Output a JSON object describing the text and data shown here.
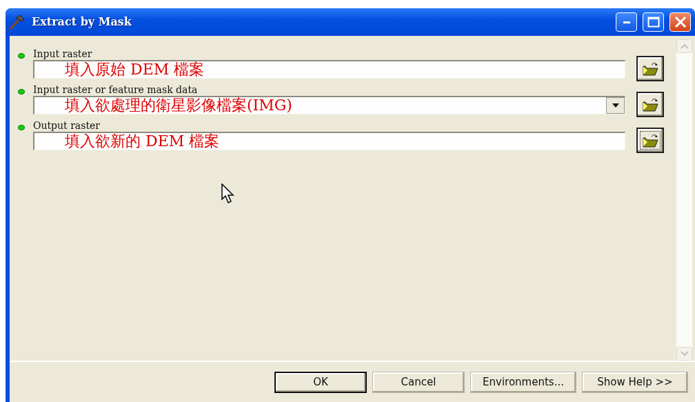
{
  "window": {
    "title": "Extract by Mask"
  },
  "parameters": [
    {
      "label": "Input raster",
      "value": "填入原始 DEM 檔案",
      "kind": "text",
      "required": true,
      "focused": false
    },
    {
      "label": "Input raster or feature mask data",
      "value": "填入欲處理的衛星影像檔案(IMG)",
      "kind": "dropdown",
      "required": true,
      "focused": false
    },
    {
      "label": "Output raster",
      "value": "填入欲新的 DEM 檔案",
      "kind": "text",
      "required": true,
      "focused": true
    }
  ],
  "buttons": [
    {
      "label": "OK",
      "default": true
    },
    {
      "label": "Cancel",
      "default": false
    },
    {
      "label": "Environments...",
      "default": false
    },
    {
      "label": "Show Help >>",
      "default": false
    }
  ]
}
